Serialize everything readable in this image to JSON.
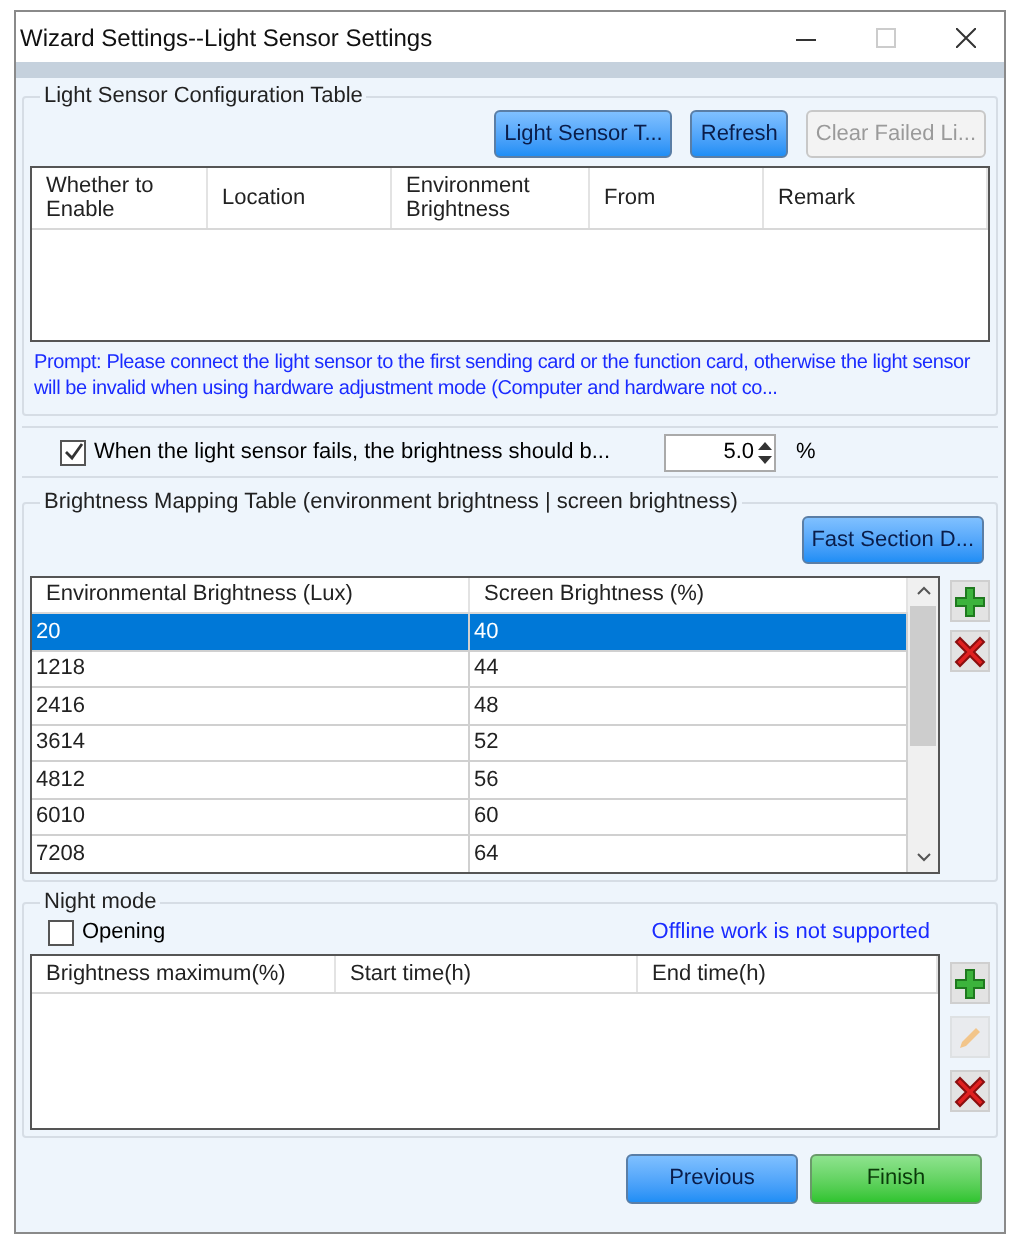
{
  "window": {
    "title": "Wizard Settings--Light Sensor Settings"
  },
  "sensor_group": {
    "legend": "Light Sensor Configuration Table",
    "buttons": [
      {
        "label": "Light Sensor T...",
        "disabled": false
      },
      {
        "label": "Refresh",
        "disabled": false
      },
      {
        "label": "Clear Failed Li...",
        "disabled": true
      }
    ],
    "table": {
      "columns": [
        "Whether to Enable",
        "Location",
        "Environment Brightness",
        "From",
        "Remark"
      ]
    },
    "prompt": "Prompt: Please connect the light sensor to the first sending card or the function card, otherwise the light sensor will be invalid when using hardware adjustment mode (Computer and hardware not co..."
  },
  "fail_option": {
    "label": "When the light sensor fails, the brightness should b...",
    "checked": true,
    "value": "5.0",
    "unit": "%"
  },
  "mapping_group": {
    "legend": "Brightness Mapping Table (environment brightness | screen brightness)",
    "button": "Fast Section D...",
    "columns": [
      "Environmental Brightness (Lux)",
      "Screen Brightness (%)"
    ],
    "rows": [
      {
        "cells": [
          "20",
          "40"
        ],
        "selected": true
      },
      {
        "cells": [
          "1218",
          "44"
        ],
        "selected": false
      },
      {
        "cells": [
          "2416",
          "48"
        ],
        "selected": false
      },
      {
        "cells": [
          "3614",
          "52"
        ],
        "selected": false
      },
      {
        "cells": [
          "4812",
          "56"
        ],
        "selected": false
      },
      {
        "cells": [
          "6010",
          "60"
        ],
        "selected": false
      },
      {
        "cells": [
          "7208",
          "64"
        ],
        "selected": false
      }
    ],
    "side_buttons": [
      {
        "kind": "add",
        "disabled": false
      },
      {
        "kind": "delete",
        "disabled": false
      }
    ]
  },
  "night_group": {
    "legend": "Night mode",
    "option": {
      "label": "Opening",
      "checked": false
    },
    "note": "Offline work is not supported",
    "columns": [
      "Brightness maximum(%)",
      "Start time(h)",
      "End time(h)"
    ],
    "side_buttons": [
      {
        "kind": "add",
        "disabled": false
      },
      {
        "kind": "edit",
        "disabled": true
      },
      {
        "kind": "delete",
        "disabled": false
      }
    ]
  },
  "footer": [
    {
      "label": "Previous",
      "kind": "blue"
    },
    {
      "label": "Finish",
      "kind": "green"
    }
  ]
}
